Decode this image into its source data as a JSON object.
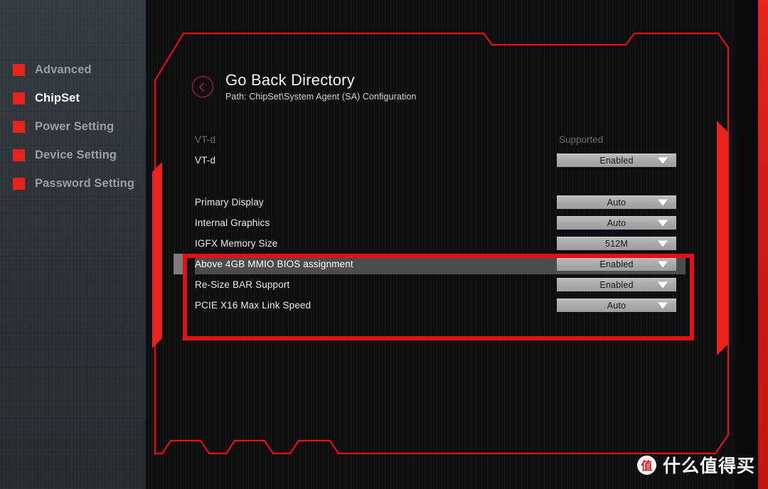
{
  "sidebar": {
    "items": [
      {
        "label": "Advanced",
        "active": false
      },
      {
        "label": "ChipSet",
        "active": true
      },
      {
        "label": "Power Setting",
        "active": false
      },
      {
        "label": "Device Setting",
        "active": false
      },
      {
        "label": "Password Setting",
        "active": false
      }
    ]
  },
  "header": {
    "back_icon": "back-chevron-circle-icon",
    "title": "Go Back Directory",
    "path": "Path: ChipSet\\System Agent (SA) Configuration"
  },
  "settings": {
    "section_header": {
      "label": "VT-d",
      "value": "Supported"
    },
    "rows": [
      {
        "label": "VT-d",
        "value": "Enabled",
        "control": "dropdown",
        "selected": false
      },
      {
        "label": "Primary Display",
        "value": "Auto",
        "control": "dropdown",
        "selected": false
      },
      {
        "label": "Internal Graphics",
        "value": "Auto",
        "control": "dropdown",
        "selected": false
      },
      {
        "label": "IGFX Memory Size",
        "value": "512M",
        "control": "dropdown",
        "selected": false
      },
      {
        "label": "Above 4GB MMIO BIOS assignment",
        "value": "Enabled",
        "control": "dropdown",
        "selected": true
      },
      {
        "label": "Re-Size BAR Support",
        "value": "Enabled",
        "control": "dropdown",
        "selected": false
      },
      {
        "label": "PCIE X16 Max Link Speed",
        "value": "Auto",
        "control": "dropdown",
        "selected": false
      }
    ]
  },
  "watermark": {
    "logo_char": "值",
    "text": "什么值得买"
  },
  "colors": {
    "accent_red": "#e8231d",
    "highlight_box_red": "#e2100e",
    "dropdown_gray": "#a9a9a9",
    "selected_row": "#4a4d50",
    "stage_bg": "#0c0d10",
    "sidebar_bg": "#2c3237"
  }
}
